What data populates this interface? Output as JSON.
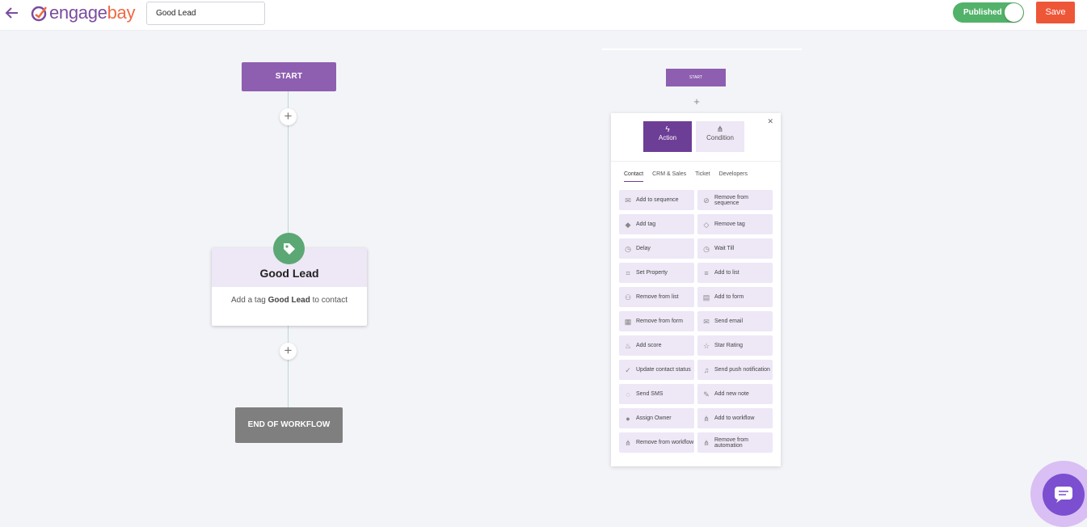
{
  "header": {
    "logo_prefix": "engage",
    "logo_suffix": "bay",
    "workflow_name": "Good Lead",
    "published_label": "Published",
    "save_label": "Save"
  },
  "flow": {
    "start_label": "START",
    "node_title": "Good Lead",
    "node_desc_prefix": "Add a tag",
    "node_desc_tag": "Good Lead",
    "node_desc_suffix": "to contact",
    "end_label": "END OF WORKFLOW"
  },
  "preview": {
    "start_label": "START"
  },
  "panel": {
    "action_label": "Action",
    "condition_label": "Condition",
    "tabs": [
      "Contact",
      "CRM & Sales",
      "Ticket",
      "Developers"
    ],
    "items": [
      {
        "label": "Add to sequence",
        "icon": "envelope-icon",
        "glyph": "✉"
      },
      {
        "label": "Remove from sequence",
        "icon": "remove-sequence-icon",
        "glyph": "⊘"
      },
      {
        "label": "Add tag",
        "icon": "tag-icon",
        "glyph": "◆"
      },
      {
        "label": "Remove tag",
        "icon": "eraser-icon",
        "glyph": "◇"
      },
      {
        "label": "Delay",
        "icon": "clock-icon",
        "glyph": "◷"
      },
      {
        "label": "Wait Till",
        "icon": "clock-icon",
        "glyph": "◷"
      },
      {
        "label": "Set Property",
        "icon": "crop-icon",
        "glyph": "⌗"
      },
      {
        "label": "Add to list",
        "icon": "list-icon",
        "glyph": "≡"
      },
      {
        "label": "Remove from list",
        "icon": "user-remove-icon",
        "glyph": "⚇"
      },
      {
        "label": "Add to form",
        "icon": "form-icon",
        "glyph": "▤"
      },
      {
        "label": "Remove from form",
        "icon": "calendar-remove-icon",
        "glyph": "▦"
      },
      {
        "label": "Send email",
        "icon": "envelope-icon",
        "glyph": "✉"
      },
      {
        "label": "Add score",
        "icon": "flame-icon",
        "glyph": "♨"
      },
      {
        "label": "Star Rating",
        "icon": "star-icon",
        "glyph": "☆"
      },
      {
        "label": "Update contact status",
        "icon": "check-circle-icon",
        "glyph": "✓"
      },
      {
        "label": "Send push notification",
        "icon": "bell-icon",
        "glyph": "♫"
      },
      {
        "label": "Send SMS",
        "icon": "chat-bubble-icon",
        "glyph": "◌"
      },
      {
        "label": "Add new note",
        "icon": "note-edit-icon",
        "glyph": "✎"
      },
      {
        "label": "Assign Owner",
        "icon": "user-icon",
        "glyph": "●"
      },
      {
        "label": "Add to workflow",
        "icon": "sitemap-icon",
        "glyph": "⋔"
      },
      {
        "label": "Remove from workflow",
        "icon": "sitemap-icon",
        "glyph": "⋔"
      },
      {
        "label": "Remove from automation",
        "icon": "sitemap-icon",
        "glyph": "⋔"
      }
    ]
  },
  "colors": {
    "brand_purple": "#7b4ba0",
    "brand_orange": "#ef6a43",
    "published_green": "#52b26a",
    "save_red": "#ee5638",
    "start_purple": "#8e5fb0",
    "end_gray": "#7f7f7f",
    "tag_green": "#5ba874"
  }
}
